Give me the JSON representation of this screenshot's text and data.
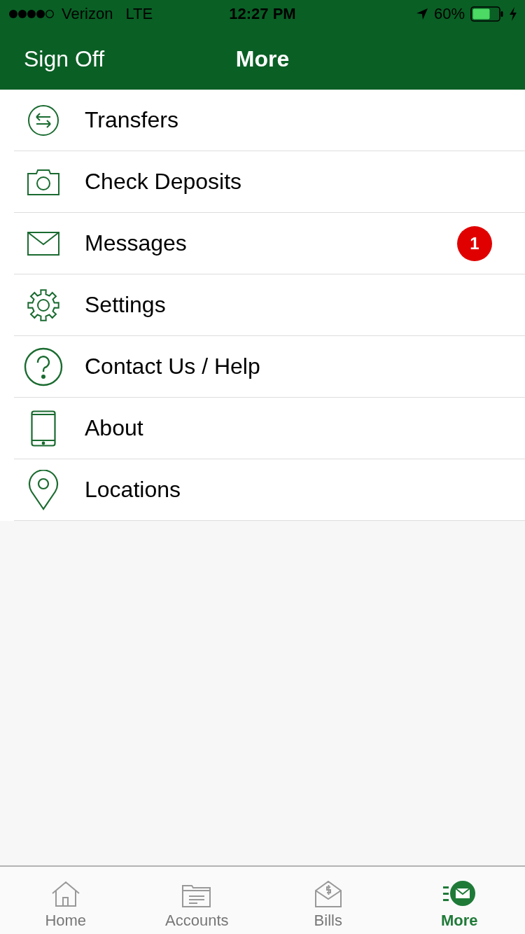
{
  "status_bar": {
    "carrier": "Verizon",
    "network": "LTE",
    "time": "12:27 PM",
    "battery": "60%"
  },
  "nav_bar": {
    "left_button": "Sign Off",
    "title": "More"
  },
  "menu": [
    {
      "kind": "transfers",
      "label": "Transfers"
    },
    {
      "kind": "camera",
      "label": "Check Deposits"
    },
    {
      "kind": "mail",
      "label": "Messages",
      "badge": "1"
    },
    {
      "kind": "gear",
      "label": "Settings"
    },
    {
      "kind": "help",
      "label": "Contact Us / Help"
    },
    {
      "kind": "tablet",
      "label": "About"
    },
    {
      "kind": "pin",
      "label": "Locations"
    }
  ],
  "tab_bar": [
    {
      "kind": "home",
      "label": "Home",
      "selected": false
    },
    {
      "kind": "folder",
      "label": "Accounts",
      "selected": false
    },
    {
      "kind": "bill",
      "label": "Bills",
      "selected": false
    },
    {
      "kind": "more",
      "label": "More",
      "selected": true
    }
  ]
}
